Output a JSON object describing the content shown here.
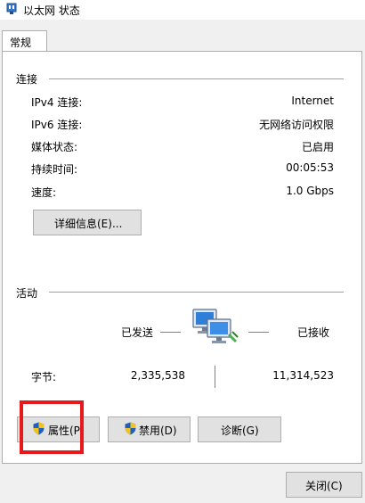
{
  "window": {
    "title": "以太网 状态"
  },
  "tabs": [
    {
      "label": "常规"
    }
  ],
  "connection": {
    "section_title": "连接",
    "rows": [
      {
        "label": "IPv4 连接:",
        "value": "Internet"
      },
      {
        "label": "IPv6 连接:",
        "value": "无网络访问权限"
      },
      {
        "label": "媒体状态:",
        "value": "已启用"
      },
      {
        "label": "持续时间:",
        "value": "00:05:53"
      },
      {
        "label": "速度:",
        "value": "1.0 Gbps"
      }
    ],
    "details_button": "详细信息(E)..."
  },
  "activity": {
    "section_title": "活动",
    "sent_label": "已发送",
    "received_label": "已接收",
    "bytes_label": "字节:",
    "bytes_sent": "2,335,538",
    "bytes_received": "11,314,523"
  },
  "buttons": {
    "properties": "属性(P",
    "disable": "禁用(D)",
    "diagnose": "诊断(G)",
    "close": "关闭(C)"
  },
  "icons": {
    "title_icon": "network-adapter-icon",
    "activity_icon": "network-computers-icon",
    "shield_icon": "uac-shield-icon"
  },
  "colors": {
    "highlight": "#e8191b",
    "shield_blue": "#1f5fbf",
    "shield_yellow": "#f2c21d"
  }
}
